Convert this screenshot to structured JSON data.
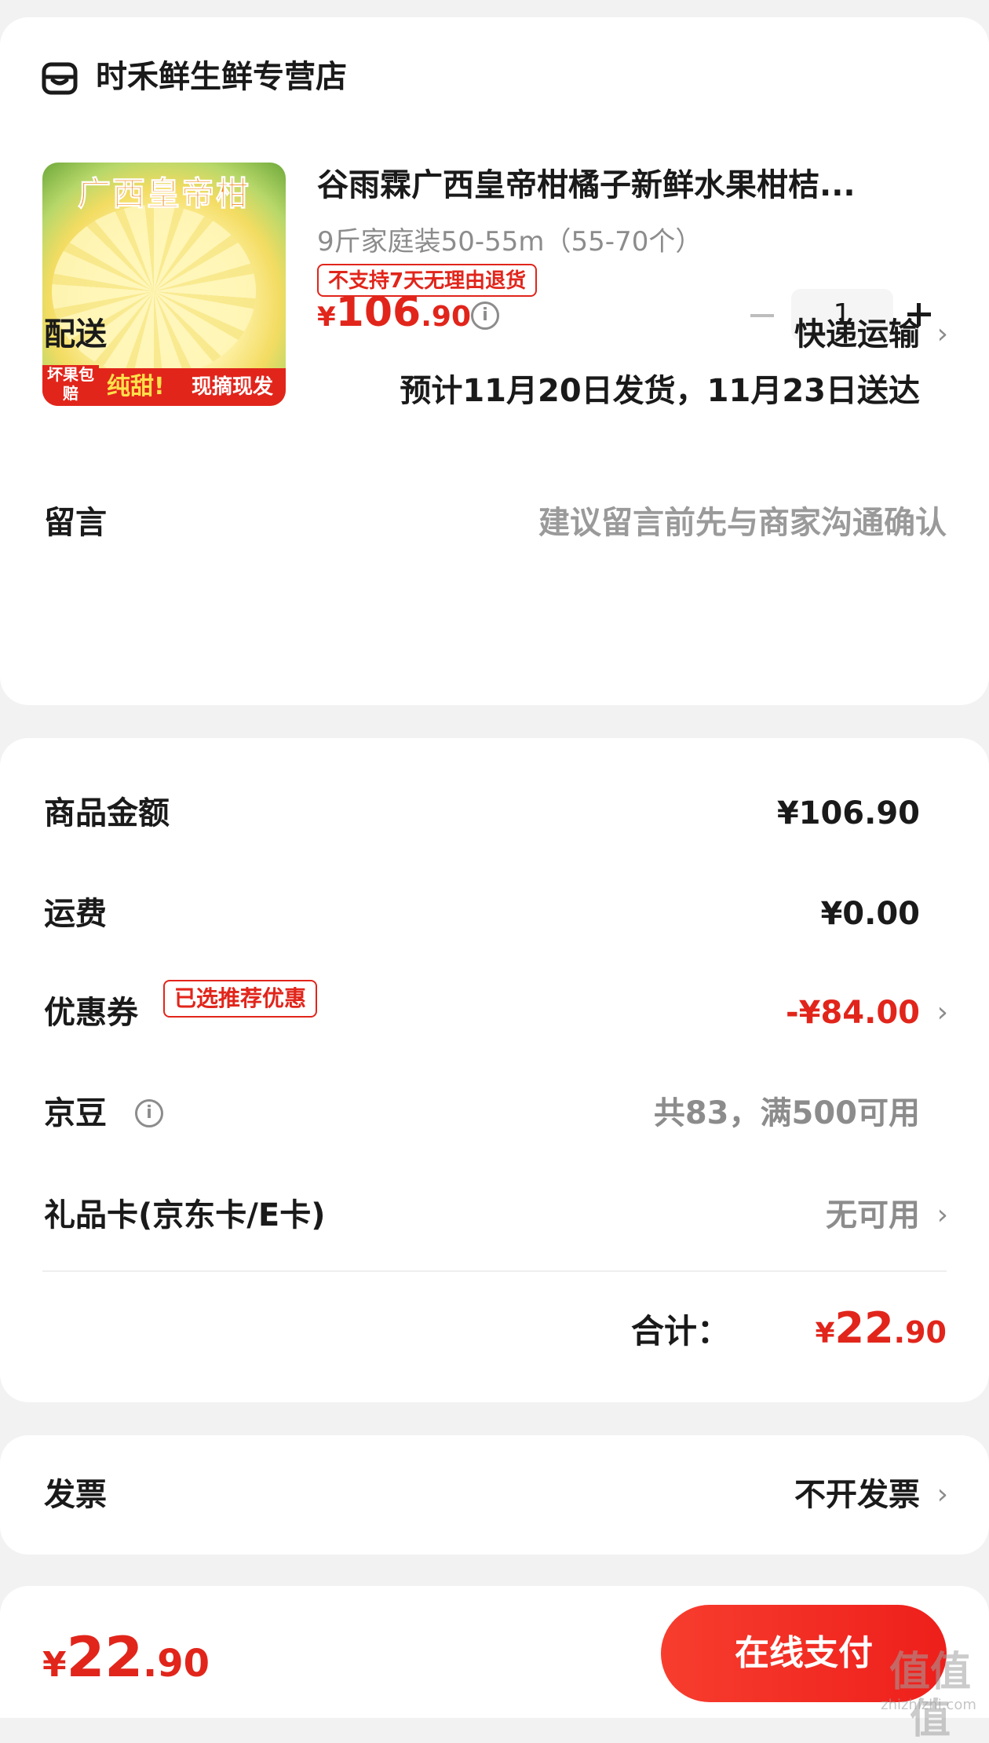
{
  "store": {
    "name": "时禾鲜生鲜专营店",
    "icon": "store-icon"
  },
  "product": {
    "title": "谷雨霖广西皇帝柑橘子新鲜水果柑桔...",
    "spec": "9斤家庭装50-55m（55-70个）",
    "price_symbol": "¥",
    "price_int": "106",
    "price_dec": ".90",
    "quantity": "1",
    "no_return_tag": "不支持7天无理由退货",
    "image_text": {
      "title": "广西皇帝柑",
      "badge": "坏果包赔",
      "sweet": "纯甜!",
      "fresh": "现摘现发"
    }
  },
  "delivery": {
    "label": "配送",
    "method": "快递运输",
    "eta": "预计11月20日发货，11月23日送达"
  },
  "message": {
    "label": "留言",
    "placeholder": "建议留言前先与商家沟通确认"
  },
  "price_summary": {
    "goods_label": "商品金额",
    "goods_value": "¥106.90",
    "shipping_label": "运费",
    "shipping_value": "¥0.00",
    "coupon_label": "优惠券",
    "coupon_tag": "已选推荐优惠",
    "coupon_value": "-¥84.00",
    "beans_label": "京豆",
    "beans_value": "共83，满500可用",
    "giftcard_label": "礼品卡(京东卡/E卡)",
    "giftcard_value": "无可用",
    "total_label": "合计：",
    "total_symbol": "¥",
    "total_int": "22",
    "total_dec": ".90"
  },
  "invoice": {
    "label": "发票",
    "value": "不开发票"
  },
  "bottom": {
    "price_symbol": "¥",
    "price_int": "22",
    "price_dec": ".90",
    "pay_label": "在线支付"
  },
  "watermark": {
    "text": "值值值",
    "sub": "zhizhizhi.com"
  },
  "colors": {
    "accent": "#e1251b",
    "background": "#f2f2f2",
    "muted": "#8c8c8c"
  },
  "chevron": "›",
  "info_glyph": "i"
}
